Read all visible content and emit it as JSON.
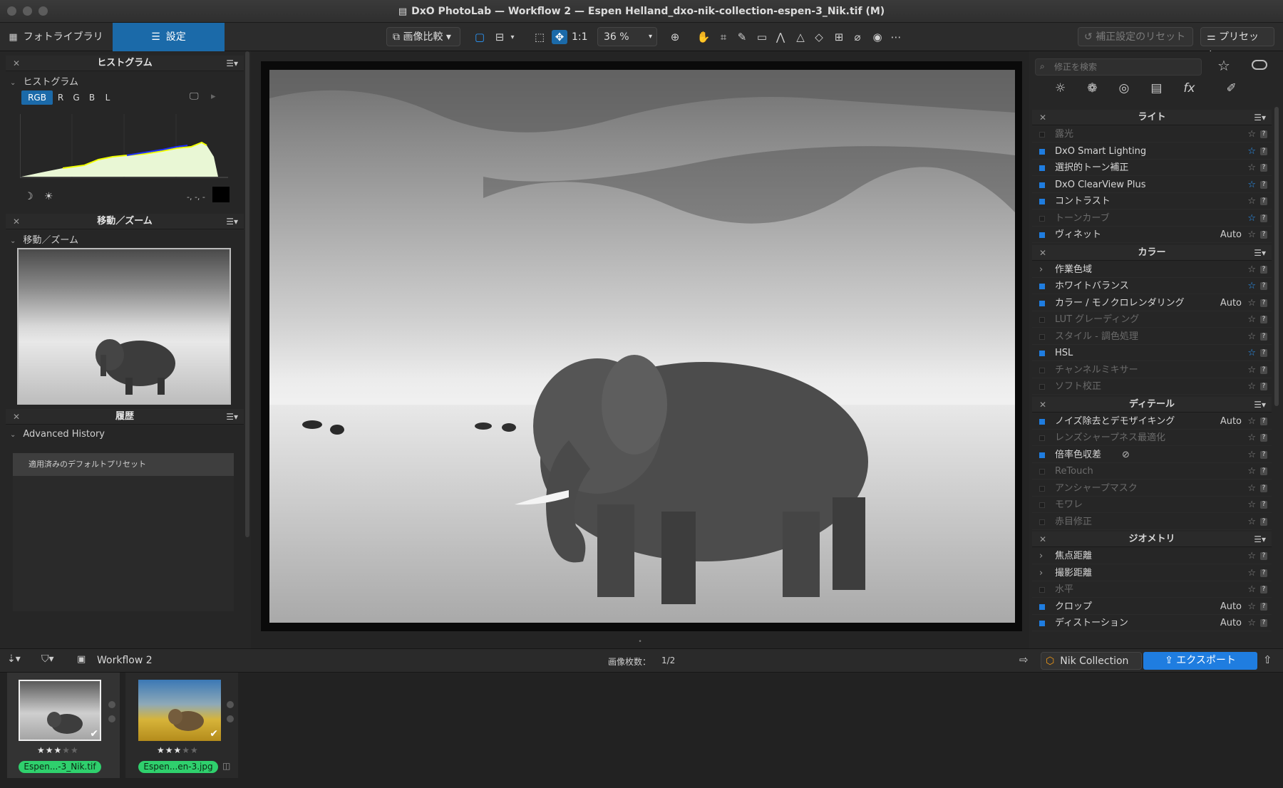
{
  "window": {
    "title": "DxO PhotoLab — Workflow 2 — Espen Helland_dxo-nik-collection-espen-3_Nik.tif (M)"
  },
  "toolbar": {
    "tab_library": "フォトライブラリ",
    "tab_settings": "設定",
    "compare_label": "画像比較",
    "one_to_one": "1:1",
    "zoom": "36 %",
    "reset_label": "補正設定のリセット",
    "presets_label": "プリセット"
  },
  "left": {
    "histogram": {
      "panel_title": "ヒストグラム",
      "section": "ヒストグラム",
      "channels": [
        "RGB",
        "R",
        "G",
        "B",
        "L"
      ],
      "value_readout": "-, -, -"
    },
    "navigator": {
      "panel_title": "移動／ズーム",
      "section": "移動／ズーム"
    },
    "history": {
      "panel_title": "履歴",
      "section": "Advanced History",
      "items": [
        "適用済みのデフォルトプリセット"
      ]
    }
  },
  "right": {
    "search_placeholder": "修正を検索",
    "groups": [
      {
        "title": "ライト",
        "items": [
          {
            "label": "露光",
            "active": false,
            "fav": false,
            "auto": ""
          },
          {
            "label": "DxO Smart Lighting",
            "active": true,
            "fav": true,
            "auto": ""
          },
          {
            "label": "選択的トーン補正",
            "active": true,
            "fav": false,
            "auto": ""
          },
          {
            "label": "DxO ClearView Plus",
            "active": true,
            "fav": true,
            "auto": ""
          },
          {
            "label": "コントラスト",
            "active": true,
            "fav": false,
            "auto": ""
          },
          {
            "label": "トーンカーブ",
            "active": false,
            "fav": true,
            "auto": ""
          },
          {
            "label": "ヴィネット",
            "active": true,
            "fav": false,
            "auto": "Auto"
          }
        ]
      },
      {
        "title": "カラー",
        "items": [
          {
            "label": "作業色域",
            "active": true,
            "fav": false,
            "auto": "",
            "expand": true
          },
          {
            "label": "ホワイトバランス",
            "active": true,
            "fav": true,
            "auto": ""
          },
          {
            "label": "カラー / モノクロレンダリング",
            "active": true,
            "fav": false,
            "auto": "Auto"
          },
          {
            "label": "LUT グレーディング",
            "active": false,
            "fav": false,
            "auto": ""
          },
          {
            "label": "スタイル - 調色処理",
            "active": false,
            "fav": false,
            "auto": ""
          },
          {
            "label": "HSL",
            "active": true,
            "fav": true,
            "auto": ""
          },
          {
            "label": "チャンネルミキサー",
            "active": false,
            "fav": false,
            "auto": ""
          },
          {
            "label": "ソフト校正",
            "active": false,
            "fav": false,
            "auto": ""
          }
        ]
      },
      {
        "title": "ディテール",
        "items": [
          {
            "label": "ノイズ除去とデモザイキング",
            "active": true,
            "fav": false,
            "auto": "Auto"
          },
          {
            "label": "レンズシャープネス最適化",
            "active": false,
            "fav": false,
            "auto": ""
          },
          {
            "label": "倍率色収差",
            "active": true,
            "fav": false,
            "auto": "",
            "hidden_icon": true
          },
          {
            "label": "ReTouch",
            "active": false,
            "fav": false,
            "auto": ""
          },
          {
            "label": "アンシャープマスク",
            "active": false,
            "fav": false,
            "auto": ""
          },
          {
            "label": "モワレ",
            "active": false,
            "fav": false,
            "auto": ""
          },
          {
            "label": "赤目修正",
            "active": false,
            "fav": false,
            "auto": ""
          }
        ]
      },
      {
        "title": "ジオメトリ",
        "items": [
          {
            "label": "焦点距離",
            "active": true,
            "fav": false,
            "auto": "",
            "expand": true
          },
          {
            "label": "撮影距離",
            "active": true,
            "fav": false,
            "auto": "",
            "expand": true
          },
          {
            "label": "水平",
            "active": false,
            "fav": false,
            "auto": ""
          },
          {
            "label": "クロップ",
            "active": true,
            "fav": false,
            "auto": "Auto"
          },
          {
            "label": "ディストーション",
            "active": true,
            "fav": false,
            "auto": "Auto"
          }
        ]
      }
    ]
  },
  "bottom": {
    "workflow_name": "Workflow 2",
    "count_label": "画像枚数：",
    "count_value": "1/2",
    "nik_label": "Nik Collection",
    "export_label": "エクスポート"
  },
  "filmstrip": [
    {
      "name": "Espen...-3_Nik.tif",
      "rating": 3,
      "selected": true
    },
    {
      "name": "Espen...en-3.jpg",
      "rating": 3,
      "selected": false
    }
  ],
  "colors": {
    "accent": "#1f7de0",
    "tab_active": "#1b6aa9",
    "filename_badge": "#2fd06d"
  }
}
